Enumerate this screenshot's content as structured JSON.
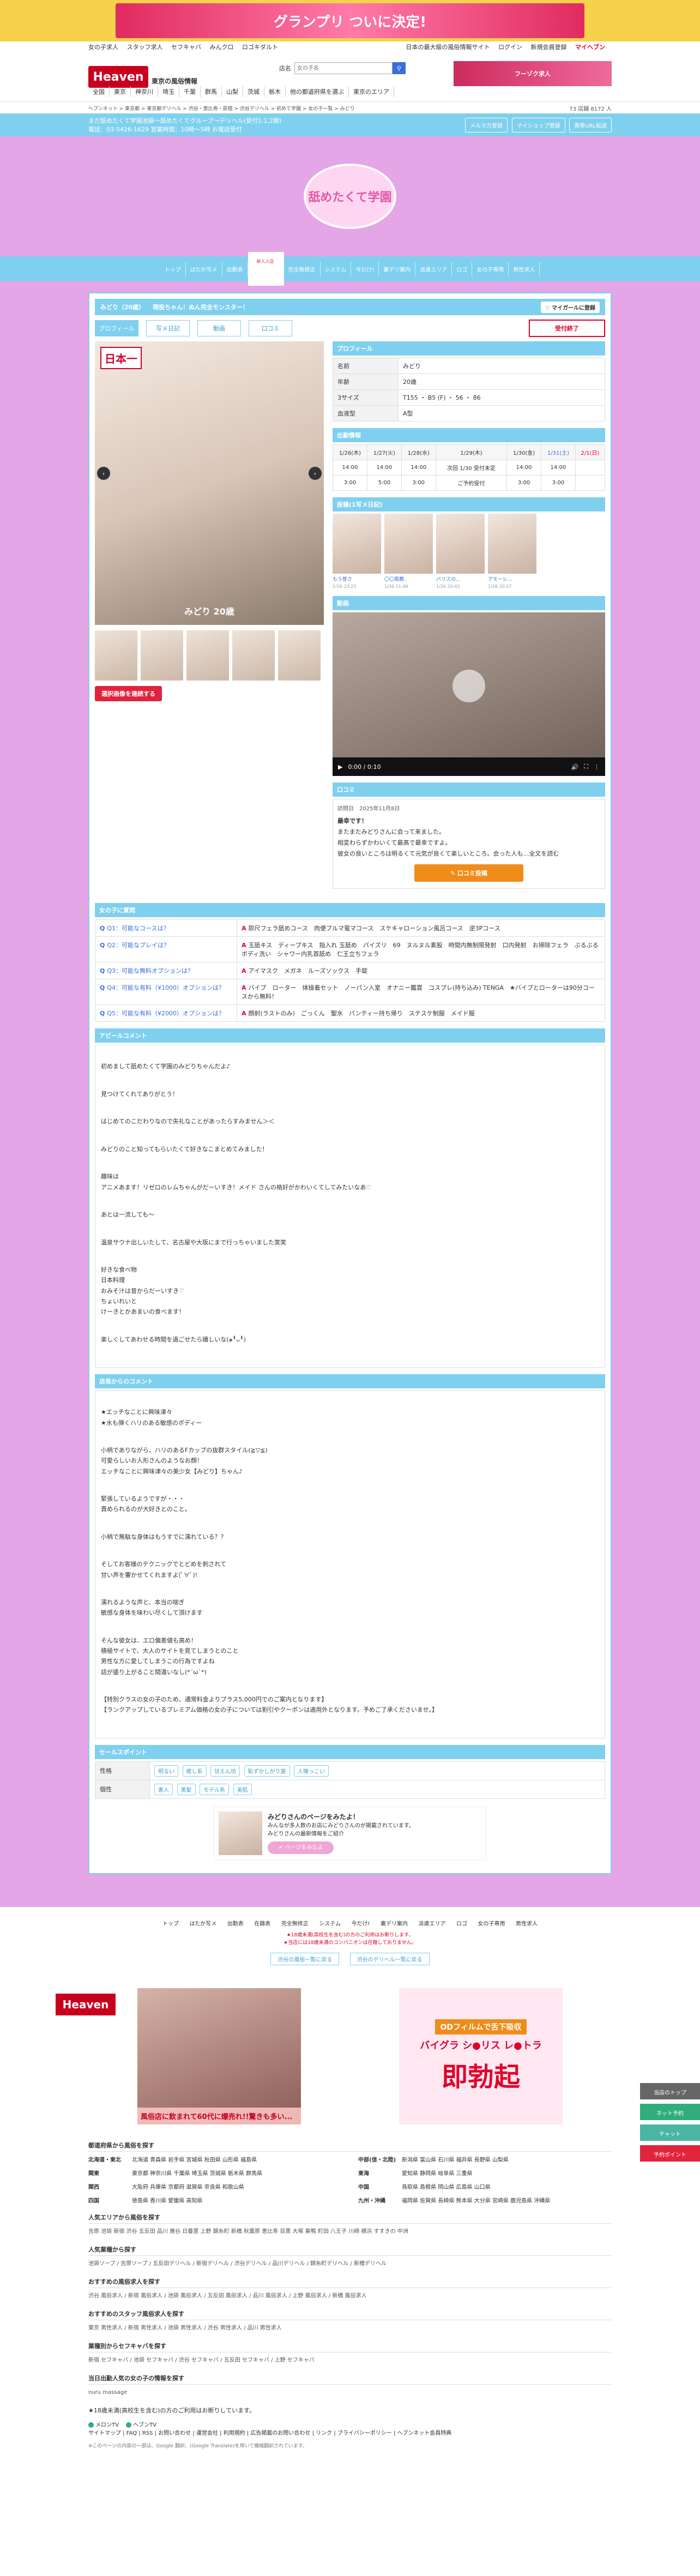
{
  "top_banner": {
    "text": "グランプリ ついに決定!"
  },
  "top_links": [
    "女の子求人",
    "スタッフ求人",
    "セフキャバ",
    "みんクロ",
    "ロゴキダルト"
  ],
  "top_right": [
    "日本の最大級の風俗情報サイト",
    "ログイン",
    "新規会員登録",
    "マイヘブン"
  ],
  "header": {
    "logo": "Heaven",
    "region": "東京の風俗情報",
    "search_label": "店名",
    "search_placeholder": "女の子名",
    "ad": "フーゾク求人"
  },
  "areas": [
    "全国",
    "東京",
    "神奈川",
    "埼玉",
    "千葉",
    "群馬",
    "山梨",
    "茨城",
    "栃木",
    "他の都道府県を選ぶ",
    "東京のエリア"
  ],
  "breadcrumb": "ヘブンネット > 東京都 > 東京都デリヘル > 渋谷・恵比寿・原宿 > 渋谷デリヘル > 初めて学園 > 女の子一覧 > みどり",
  "stats": "73 店舗  8172 人",
  "shopbar": {
    "line1": "まだ舐めたくて学園池袋～舐めたくてグループ～デリヘル(受付1:1,2開)",
    "line2": "電話：03-5426-1629 営業時間：10時～5時 お電話受付",
    "buttons": [
      "メルマガ登録",
      "マイショップ登録",
      "携帯URL転送"
    ]
  },
  "shop_logo": "舐めたくて学園",
  "gnav": [
    "トップ",
    "はたか写メ",
    "出勤表",
    "在籍表",
    "完全無修正",
    "システム",
    "今だけ!",
    "裏デリ案内",
    "派遣エリア",
    "ロゴ",
    "女の子専用",
    "男性求人"
  ],
  "gnav_new": "新人入店",
  "profile_title": "みどり（20歳） 　現役ちゃん！ぬん完全モンスター！",
  "fav_button": "マイガールに登録",
  "tabs": [
    "プロフィール",
    "写メ日記",
    "動画",
    "口コミ"
  ],
  "status": "受付終了",
  "photo": {
    "badge": "日本一",
    "label": "みどり 20歳"
  },
  "thumb_button": "選択画像を連続する",
  "profile": {
    "heading": "プロフィール",
    "rows": [
      [
        "名前",
        "みどり"
      ],
      [
        "年齢",
        "20歳"
      ],
      [
        "3サイズ",
        "T155 ・ B5 (F) ・ 56 ・ 86"
      ],
      [
        "血液型",
        "A型"
      ]
    ]
  },
  "schedule": {
    "heading": "出勤情報",
    "days": [
      "1/26(木)",
      "1/27(火)",
      "1/28(水)",
      "1/29(木)",
      "1/30(金)",
      "1/31(土)",
      "2/1(日)"
    ],
    "rows": [
      [
        "14:00",
        "14:00",
        "14:00",
        "次回 1/30 受付未定",
        "14:00",
        "14:00",
        ""
      ],
      [
        "3:00",
        "5:00",
        "3:00",
        "ご予約受付",
        "3:00",
        "3:00",
        ""
      ]
    ]
  },
  "posts": {
    "heading": "投稿(1写メ日記)",
    "items": [
      {
        "title": "もう昔さ",
        "date": "1/26 23:25"
      },
      {
        "title": "〇〇風蘭..",
        "date": "1/26 21:46"
      },
      {
        "title": "バリスの...",
        "date": "1/26 20:43"
      },
      {
        "title": "アモーレ...",
        "date": "1/26 20:27"
      }
    ]
  },
  "video": {
    "heading": "動画",
    "time": "0:00 / 0:10"
  },
  "review": {
    "heading": "口コミ",
    "meta_label": "訪問日",
    "meta_date": "2025年11月8日",
    "lines": [
      "最幸です！",
      "またまたみどりさんに会って来ました。",
      "相変わらずかわいくて最高で最幸ですよ。",
      "彼女の良いところは明るくて元気が良くて楽しいところ。会った人も…全文を読む"
    ],
    "button": "口コミ投稿"
  },
  "qa": {
    "heading": "女の子に質問",
    "rows": [
      [
        "Q1：可能なコースは？",
        "即尺フェラ舐めコース　肉便プルマ電マコース　スケキャローション風呂コース　逆3Pコース"
      ],
      [
        "Q2：可能なプレイは？",
        "玉舐キス　ディープキス　指入れ 玉舐め　パイズリ　69　ヌルヌル素股　時間内無制限発射　口内発射　お掃除フェラ　ぶるぶるボディ洗い　シャワー内乳首舐め　仁王立ちフェラ"
      ],
      [
        "Q3：可能な無料オプションは？",
        "アイマスク　メガネ　ルーズソックス　手錠"
      ],
      [
        "Q4：可能な有料（¥1000）オプションは？",
        "バイブ　ローター　体操着セット　ノーパン入室　オナニー鑑賞　コスプレ(持ち込み) TENGA　★バイブとローターは90分コースから無料！"
      ],
      [
        "Q5：可能な有料（¥2000）オプションは？",
        "顔射(ラストのみ)　ごっくん　聖水　パンティー持ち帰り　ステスケ制服　メイド服"
      ]
    ]
  },
  "appeal": {
    "heading": "アピールコメント",
    "paras": [
      "初めまして舐めたくて学園のみどりちゃんだよ♪",
      "見つけてくれてありがとう！",
      "はじめてのこだわりなので失礼なことがあったらすみません＞＜",
      "みどりのこと知ってもらいたくて好きなこまとめてみました！",
      "趣味は\nアニメあます！リゼロのレムちゃんがだーいすき！メイド さんの格好がかわいくてしてみたいなあ♡",
      "あとは一流しても〜",
      "温泉サウナ出しいたして、名古屋や大阪にまで行っちゃいました笑笑",
      "好きな食べ物\n日本料理\nおみそ汁は昔からだーいすき♡\nちょいれいと\nけーきとかあまいの食べます！",
      "楽しくしてあわせる時間を過ごせたら嬉しいな(๑╹ᴗ╹)"
    ]
  },
  "shop_comment": {
    "heading": "店長からのコメント",
    "paras": [
      "★エッチなことに興味津々\n★水も弾くハリのある敏感のボディー",
      "小柄でありながら、ハリのあるFカップの抜群スタイル(≧▽≦)\n可愛らしいお人形さんのようなお顔！\nエッチなことに興味津々の美少女【みどり】ちゃん♪",
      "緊張しているようですが・・・\n責められるのが大好きとのこと。",
      "小柄で無駄な身体はもうすでに濡れている？？",
      "そしてお客様のテクニックでとどめを刺されて\n甘い声を響かせてくれますよ(ﾟ∀ﾟ)!",
      "濡れるような声と、本当の喘ぎ\n敏感な身体を味わい尽くして頂けます",
      "そんな彼女は、エロ偏差値も高め！\n積極サイトで、大人のサイトを見てしまうとのこと\n男性な方に愛してしまうこの行為ですよね\n話が盛り上がること間違いなし(*´ω`*)",
      "【特別クラスの女の子のため、通常料金よりプラス5,000円でのご案内となります】\n【ランクアップしているプレミアム価格の女の子については割引やクーポンは適用外となります。予めご了承くださいませ。】"
    ]
  },
  "sales": {
    "heading": "セールスポイント",
    "rows": [
      {
        "label": "性格",
        "tags": [
          "明るい",
          "癒し系",
          "甘えん坊",
          "恥ずかしがり屋",
          "人懐っこい"
        ]
      },
      {
        "label": "個性",
        "tags": [
          "素人",
          "黒髪",
          "モデル系",
          "美肌"
        ]
      }
    ]
  },
  "promo": {
    "text": "みどりさんのページをみたよ！",
    "sub1": "みんなが多人数のお店にみどりさんのが掲載されています。",
    "sub2": "みどりさんの最新情報をご紹介",
    "button": "ページをみたよ"
  },
  "foot_nav": [
    "トップ",
    "はたか写メ",
    "出勤表",
    "在籍表",
    "完全無修正",
    "システム",
    "今だけ!",
    "裏デリ案内",
    "派遣エリア",
    "ロゴ",
    "女の子専用",
    "男性求人"
  ],
  "foot_notes": [
    "★18歳未満(高校生を含む)の方のご利用はお断りします。",
    "★当店には18歳未満のコンパニオンは在籍しておりません。"
  ],
  "foot_links": [
    "渋谷の風俗一覧に戻る",
    "渋谷のデリヘル一覧に戻る"
  ],
  "side_float": [
    "当店のトップ",
    "ネット予約",
    "チャット",
    "予約ポイント"
  ],
  "ad1": {
    "logo": "Heaven",
    "text": "風俗店に飲まれて60代に爆売れ!!驚きも多い..."
  },
  "ad2": {
    "head": "ODフィルムで舌下吸収",
    "mid": "バイグラ シ●リス レ●トラ",
    "big": "即勃起"
  },
  "footer_sections": [
    {
      "title": "都道府県から風俗を探す",
      "grid": [
        [
          "北海道・東北",
          "北海道 青森県 岩手県 宮城県 秋田県 山形県 福島県"
        ],
        [
          "中部(信・北陸)",
          "新潟県 富山県 石川県 福井県 長野県 山梨県"
        ],
        [
          "関東",
          "東京都 神奈川県 千葉県 埼玉県 茨城県 栃木県 群馬県"
        ],
        [
          "東海",
          "愛知県 静岡県 岐阜県 三重県"
        ],
        [
          "関西",
          "大阪府 兵庫県 京都府 滋賀県 奈良県 和歌山県"
        ],
        [
          "中国",
          "鳥取県 島根県 岡山県 広島県 山口県"
        ],
        [
          "四国",
          "徳島県 香川県 愛媛県 高知県"
        ],
        [
          "九州・沖縄",
          "福岡県 佐賀県 長崎県 熊本県 大分県 宮崎県 鹿児島県 沖縄県"
        ]
      ]
    },
    {
      "title": "人気エリアから風俗を探す",
      "line": "吉原 池袋 新宿 渋谷 五反田 品川 鶯谷 日暮里 上野 錦糸町 新橋 秋葉原 恵比寿 目黒 大塚 巣鴨 町田 八王子 川崎 横浜 すすきの 中洲"
    },
    {
      "title": "人気業種から探す",
      "line": "池袋ソープ / 吉原ソープ / 五反田デリヘル / 新宿デリヘル / 渋谷デリヘル / 品川デリヘル / 錦糸町デリヘル / 新橋デリヘル"
    },
    {
      "title": "おすすめの風俗求人を探す",
      "line": "渋谷 風俗求人 / 新宿 風俗求人 / 池袋 風俗求人 / 五反田 風俗求人 / 品川 風俗求人 / 上野 風俗求人 / 新橋 風俗求人"
    },
    {
      "title": "おすすめのスタッフ風俗求人を探す",
      "line": "東京 男性求人 / 新宿 男性求人 / 池袋 男性求人 / 渋谷 男性求人 / 品川 男性求人"
    },
    {
      "title": "業種別からセフキャバを探す",
      "line": "新宿 セフキャバ / 池袋 セフキャバ / 渋谷 セフキャバ / 五反田 セフキャバ / 上野 セフキャバ"
    },
    {
      "title": "当日出勤人気の女の子の情報を探す",
      "line": "nuru massage"
    }
  ],
  "footer_note": "★18歳未満(高校生を含む)の方のご利用はお断りしています。",
  "footer_bottom": [
    "サイトマップ",
    "FAQ",
    "RSS",
    "お問い合わせ",
    "運営会社",
    "利用規約",
    "広告掲載のお問い合わせ",
    "リンク",
    "プライバシーポリシー",
    "ヘブンネット会員特典"
  ],
  "footer_brands": [
    "メロンTV",
    "ヘブンTV"
  ],
  "copyright": "※このページの内容の一部は、Google 翻訳、(Google Translate)を用いて機械翻訳されています。"
}
